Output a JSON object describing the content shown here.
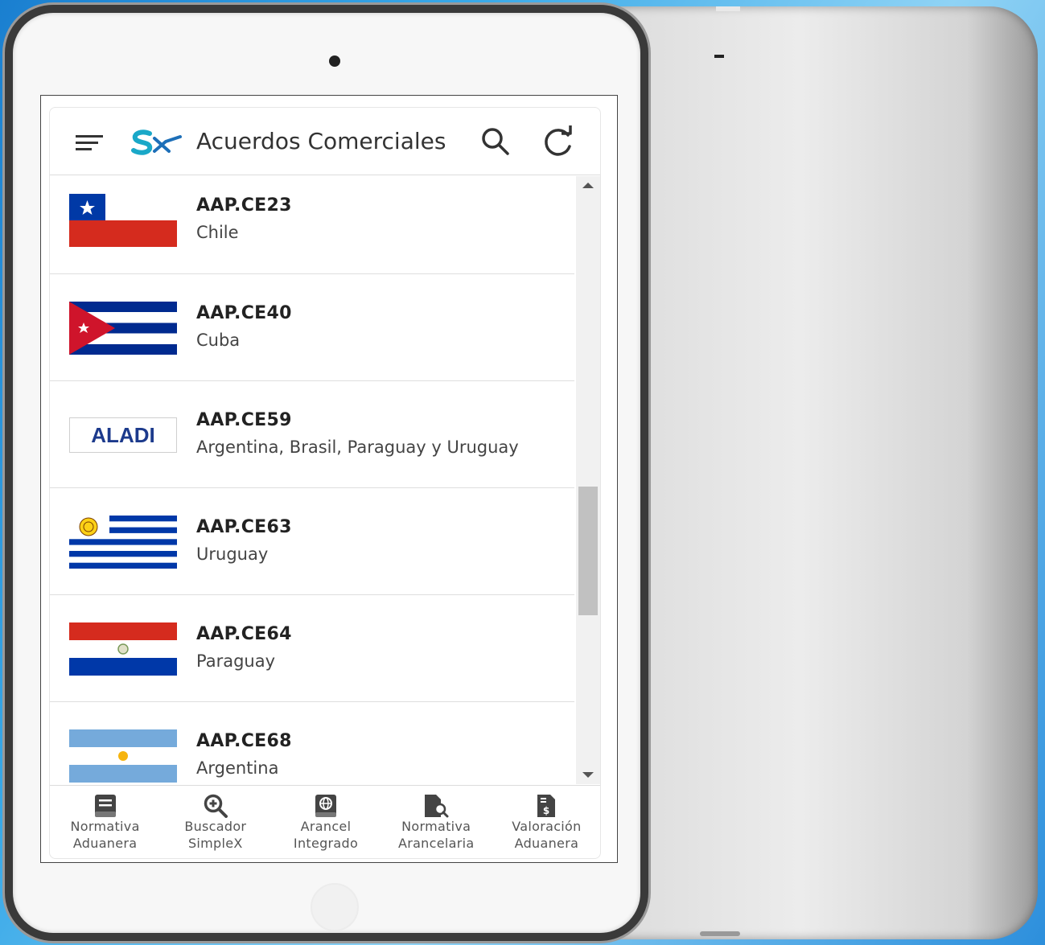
{
  "app": {
    "title": "Acuerdos Comerciales",
    "accent": "#1aa8c8"
  },
  "agreements": [
    {
      "code": "AAP.CE23",
      "name": "Chile",
      "flag": "chile-flag"
    },
    {
      "code": "AAP.CE40",
      "name": "Cuba",
      "flag": "cuba-flag"
    },
    {
      "code": "AAP.CE59",
      "name": "Argentina, Brasil, Paraguay y Uruguay",
      "flag": "aladi-logo",
      "logo_text": "ALADI"
    },
    {
      "code": "AAP.CE63",
      "name": "Uruguay",
      "flag": "uruguay-flag"
    },
    {
      "code": "AAP.CE64",
      "name": "Paraguay",
      "flag": "paraguay-flag"
    },
    {
      "code": "AAP.CE68",
      "name": "Argentina",
      "flag": "argentina-flag"
    }
  ],
  "bottom_nav": [
    {
      "line1": "Normativa",
      "line2": "Aduanera",
      "icon": "book-icon"
    },
    {
      "line1": "Buscador",
      "line2": "SimpleX",
      "icon": "zoom-in-icon"
    },
    {
      "line1": "Arancel",
      "line2": "Integrado",
      "icon": "globe-book-icon"
    },
    {
      "line1": "Normativa",
      "line2": "Arancelaria",
      "icon": "document-search-icon"
    },
    {
      "line1": "Valoración",
      "line2": "Aduanera",
      "icon": "invoice-dollar-icon"
    }
  ],
  "colors": {
    "chile_red": "#d52b1e",
    "chile_blue": "#0039a6",
    "cuba_blue": "#002a8f",
    "cuba_red": "#cf142b",
    "uruguay_blue": "#0038a8",
    "paraguay_red": "#d52b1e",
    "paraguay_blue": "#0038a8",
    "argentina_blue": "#75aadb",
    "aladi_text": "#1c3a8c"
  }
}
